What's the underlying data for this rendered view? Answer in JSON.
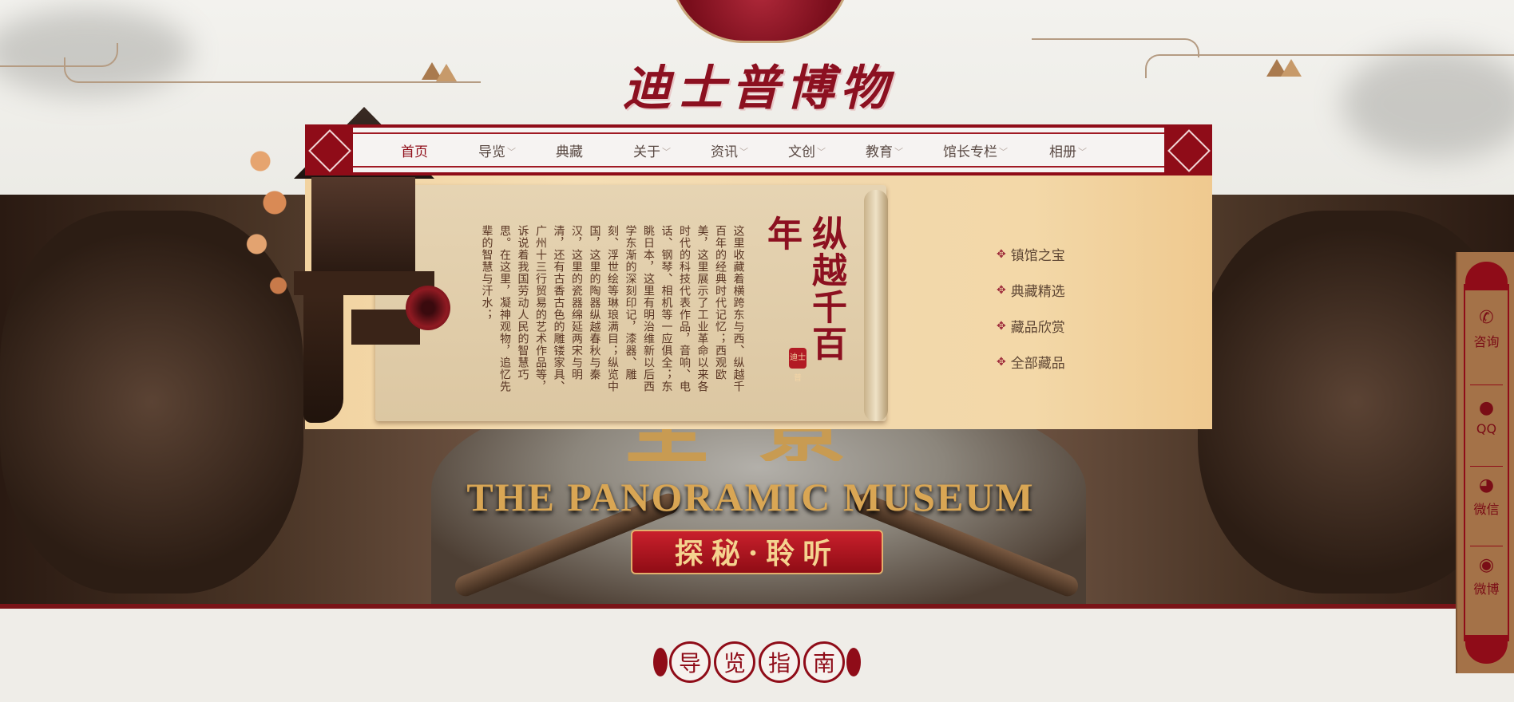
{
  "site": {
    "logo_text": "迪士普博物馆"
  },
  "nav": {
    "items": [
      {
        "label": "首页",
        "active": true,
        "has_dropdown": false
      },
      {
        "label": "导览",
        "active": false,
        "has_dropdown": true
      },
      {
        "label": "典藏",
        "active": false,
        "has_dropdown": false
      },
      {
        "label": "关于",
        "active": false,
        "has_dropdown": true
      },
      {
        "label": "资讯",
        "active": false,
        "has_dropdown": true
      },
      {
        "label": "文创",
        "active": false,
        "has_dropdown": true
      },
      {
        "label": "教育",
        "active": false,
        "has_dropdown": true
      },
      {
        "label": "馆长专栏",
        "active": false,
        "has_dropdown": true
      },
      {
        "label": "相册",
        "active": false,
        "has_dropdown": true
      }
    ],
    "chevron_icon": "chevron-down-icon"
  },
  "dropdown": {
    "calligraphy": "纵越千百年",
    "seal": "迪士普",
    "intro_text": "这里收藏着横跨东与西、纵越千百年的经典时代记忆；西观欧美，这里展示了工业革命以来各时代的科技代表作品，音响、电话、钢琴、相机等一应俱全；东眺日本，这里有明治维新以后西学东渐的深刻印记，漆器、雕刻、浮世绘等琳琅满目；纵览中国，这里的陶器纵越春秋与秦汉，这里的瓷器绵延两宋与明清，还有古香古色的雕镂家具、广州十三行贸易的艺术作品等，诉说着我国劳动人民的智慧巧思。在这里，凝神观物，追忆先辈的智慧与汗水；",
    "sub_items": [
      {
        "label": "镇馆之宝"
      },
      {
        "label": "典藏精选"
      },
      {
        "label": "藏品欣赏"
      },
      {
        "label": "全部藏品"
      }
    ]
  },
  "banner": {
    "title_cn": "全景",
    "title_en": "THE PANORAMIC MUSEUM",
    "button_label": "探秘·聆听"
  },
  "side_float": {
    "items": [
      {
        "label": "咨询",
        "icon": "phone-icon",
        "glyph": "✆"
      },
      {
        "label": "QQ",
        "icon": "qq-icon",
        "glyph": "●"
      },
      {
        "label": "微信",
        "icon": "wechat-icon",
        "glyph": "◕"
      },
      {
        "label": "微博",
        "icon": "weibo-icon",
        "glyph": "◉"
      }
    ]
  },
  "guide": {
    "chars": [
      "导",
      "览",
      "指",
      "南"
    ]
  },
  "colors": {
    "brand_red": "#8f0c18",
    "gold": "#d9a654",
    "nav_text": "#5a4a44"
  }
}
